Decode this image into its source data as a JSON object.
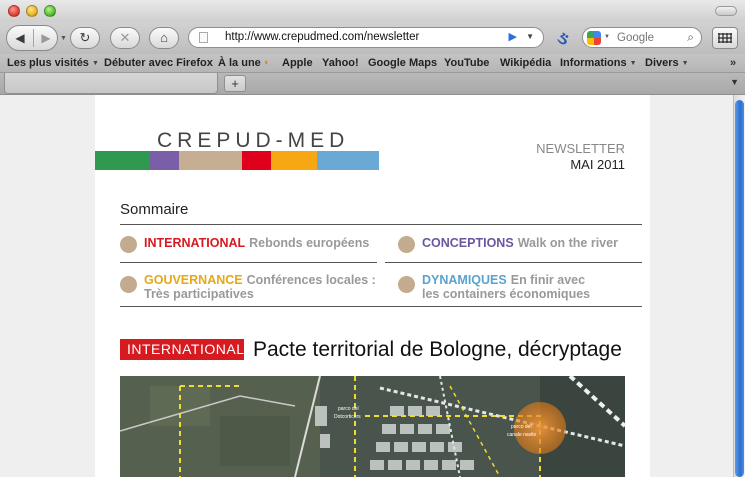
{
  "browser": {
    "url": "http://www.crepudmed.com/newsletter",
    "search_placeholder": "Google",
    "new_tab_label": "+",
    "bookmarks": [
      {
        "label": "Les plus visités",
        "has_menu": true
      },
      {
        "label": "Débuter avec Firefox",
        "has_menu": false
      },
      {
        "label": "À la une",
        "has_menu": true
      },
      {
        "label": "Apple",
        "has_menu": false
      },
      {
        "label": "Yahoo!",
        "has_menu": false
      },
      {
        "label": "Google Maps",
        "has_menu": false
      },
      {
        "label": "YouTube",
        "has_menu": false
      },
      {
        "label": "Wikipédia",
        "has_menu": false
      },
      {
        "label": "Informations",
        "has_menu": true
      },
      {
        "label": "Divers",
        "has_menu": true
      }
    ],
    "bookmarks_overflow": "»"
  },
  "newsletter": {
    "logo": "CREPUD-MED",
    "logo_colors": [
      "#2f9a4f",
      "#7b5ea8",
      "#c5ae92",
      "#e0001b",
      "#f7a711",
      "#6aa8d5"
    ],
    "label": "NEWSLETTER",
    "date": "MAI 2011",
    "sommaire_title": "Sommaire",
    "sommaire": [
      {
        "category": "INTERNATIONAL",
        "color": "#d71920",
        "text": "Rebonds européens"
      },
      {
        "category": "CONCEPTIONS",
        "color": "#6b55a0",
        "text": "Walk on the river"
      },
      {
        "category": "GOUVERNANCE",
        "color": "#e6a817",
        "text": "Conférences locales :",
        "text2": "Très participatives"
      },
      {
        "category": "DYNAMIQUES",
        "color": "#5aa3cf",
        "text": "En finir avec",
        "text2": "les containers économiques"
      }
    ],
    "article": {
      "tag": "INTERNATIONAL",
      "title": "Pacte territorial de Bologne, décryptage",
      "map_labels": [
        "parco del",
        "Dotcorticers",
        "parco del",
        "canale navile"
      ]
    }
  }
}
